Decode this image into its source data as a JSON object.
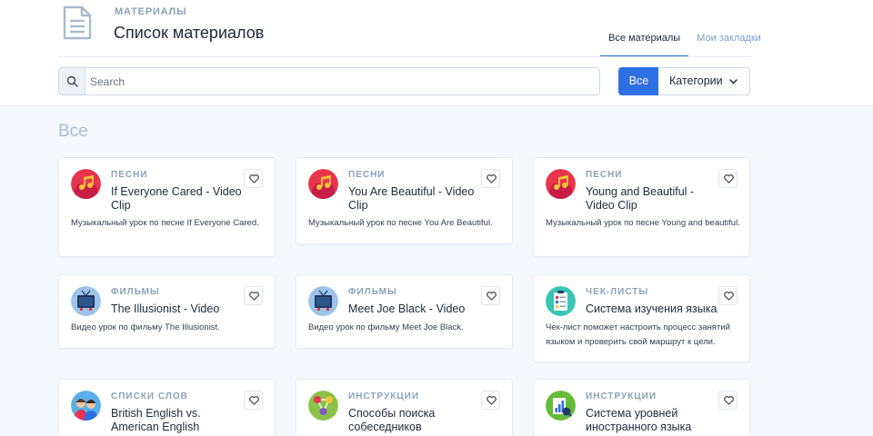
{
  "header": {
    "overline": "МАТЕРИАЛЫ",
    "title": "Список материалов",
    "icon": "document-icon",
    "tabs": [
      {
        "label": "Все материалы",
        "active": true
      },
      {
        "label": "Мои закладки",
        "active": false
      }
    ]
  },
  "search": {
    "placeholder": "Search",
    "value": ""
  },
  "filters": {
    "all_label": "Все",
    "categories_label": "Категории"
  },
  "section": {
    "title": "Все"
  },
  "colors": {
    "accent": "#2f6fe4",
    "category_text": "#8ea0b8",
    "section_title": "#a9bdd2",
    "tab_inactive": "#7d9bc9"
  },
  "cards": [
    {
      "category": "ПЕСНИ",
      "title": "If Everyone Cared - Video Clip",
      "description": "Музыкальный урок по песне If Everyone Cared.",
      "icon": "music-icon"
    },
    {
      "category": "ПЕСНИ",
      "title": "You Are Beautiful - Video Clip",
      "description": "Музыкальный урок по песне You Are Beautiful.",
      "icon": "music-icon"
    },
    {
      "category": "ПЕСНИ",
      "title": "Young and Beautiful - Video Clip",
      "description": "Музыкальный урок по песне Young and beautiful.",
      "icon": "music-icon"
    },
    {
      "category": "ФИЛЬМЫ",
      "title": "The Illusionist - Video",
      "description": "Видео урок по фильму The Illusionist.",
      "icon": "tv-icon"
    },
    {
      "category": "ФИЛЬМЫ",
      "title": "Meet Joe Black - Video",
      "description": "Видео урок по фильму Meet Joe Black.",
      "icon": "tv-icon"
    },
    {
      "category": "ЧЕК-ЛИСТЫ",
      "title": "Система изучения языка",
      "description": "Чек-лист поможет настроить процесс занятий языком и проверить свой маршрут к цели.",
      "icon": "checklist-icon"
    },
    {
      "category": "СПИСКИ СЛОВ",
      "title": "British English vs. American English",
      "description": "",
      "icon": "people-icon"
    },
    {
      "category": "ИНСТРУКЦИИ",
      "title": "Способы поиска собеседников",
      "description": "",
      "icon": "network-icon"
    },
    {
      "category": "ИНСТРУКЦИИ",
      "title": "Система уровней иностранного языка",
      "description": "",
      "icon": "levels-icon"
    }
  ]
}
